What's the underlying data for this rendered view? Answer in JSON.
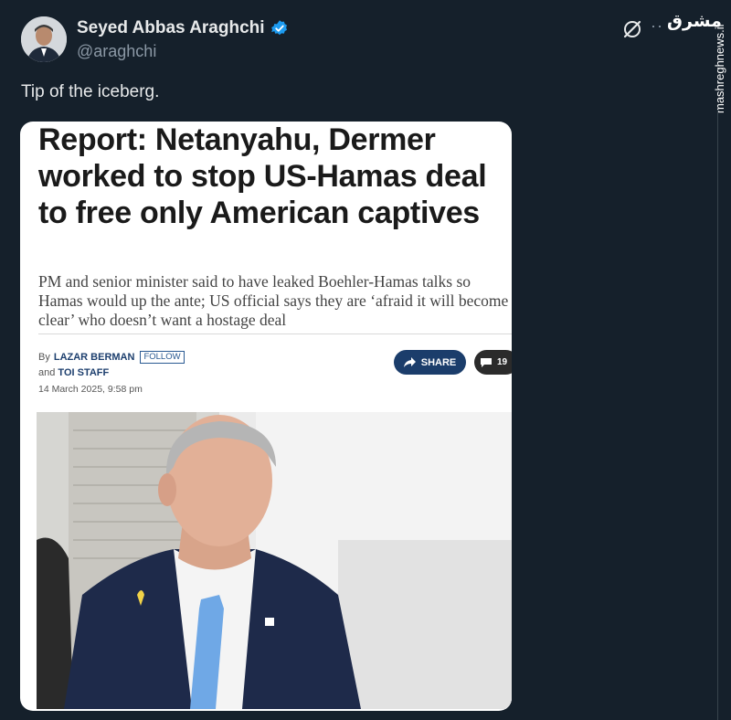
{
  "tweet": {
    "author_name": "Seyed Abbas Araghchi",
    "author_handle": "@araghchi",
    "text": "Tip of the iceberg."
  },
  "header_icons": [
    "verified-badge-icon",
    "grok-icon",
    "more-icon"
  ],
  "watermark": {
    "logo": "مشرق",
    "site": "mashreghnews.ir"
  },
  "article_card": {
    "headline": "Report: Netanyahu, Dermer worked to stop US-Hamas deal to free only American captives",
    "subhead": "PM and senior minister said to have leaked Boehler-Hamas talks so Hamas would up the ante; US official says they are ‘afraid it will become clear’ who doesn’t want a hostage deal",
    "byline_prefix": "By",
    "author_1": "LAZAR BERMAN",
    "follow_label": "FOLLOW",
    "byline_and": "and",
    "author_2": "TOI STAFF",
    "date": "14 March 2025, 9:58 pm",
    "share_label": "SHARE",
    "comment_count": "19"
  },
  "colors": {
    "background": "#15202b",
    "verified": "#1d9bf0",
    "share_button": "#1b3d6b"
  }
}
